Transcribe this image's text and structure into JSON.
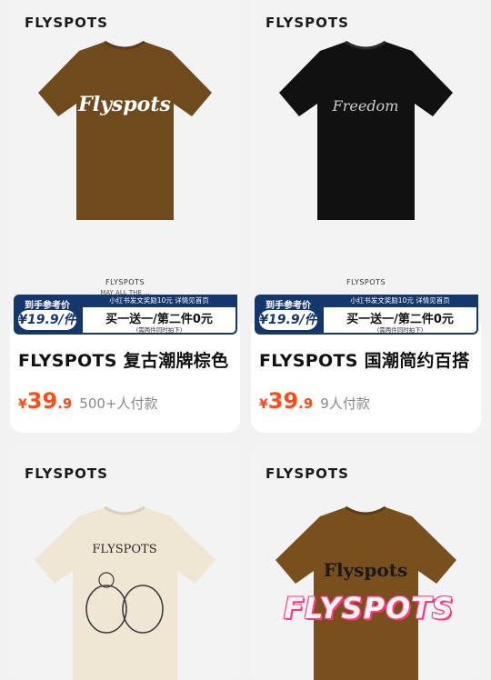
{
  "products": [
    {
      "logo": "FLYSPOTS",
      "shirt_print": "Flyspots",
      "brand_small": "FLYSPOTS",
      "tagline": "MAY ALL THE ...",
      "promo_label": "到手参考价",
      "promo_price": "¥19.9/件",
      "promo_top": "小红书发文奖励10元 详情见首页",
      "promo_deal": "买一送一/第二件0元",
      "promo_note": "(需两件同时拍下)",
      "title": "FLYSPOTS 复古潮牌棕色",
      "currency": "¥",
      "price_int": "39",
      "price_dec": ".9",
      "paid": "500+人付款",
      "shirt_color": "#6f4a1d",
      "print_color": "#ffffff"
    },
    {
      "logo": "FLYSPOTS",
      "shirt_print": "Freedom",
      "brand_small": "FLYSPOTS",
      "tagline": "",
      "promo_label": "到手参考价",
      "promo_price": "¥19.9/件",
      "promo_top": "小红书发文奖励10元 详情见首页",
      "promo_deal": "买一送一/第二件0元",
      "promo_note": "(需两件同时拍下)",
      "title": "FLYSPOTS 国潮简约百搭",
      "currency": "¥",
      "price_int": "39",
      "price_dec": ".9",
      "paid": "9人付款",
      "shirt_color": "#111111",
      "print_color": "#cccccc"
    },
    {
      "logo": "FLYSPOTS",
      "shirt_print": "FLYSPOTS",
      "shirt_color": "#efe6d4",
      "print_color": "#2b2b2b"
    },
    {
      "logo": "FLYSPOTS",
      "shirt_print": "Flyspots",
      "overlay": "FLYSPOTS",
      "shirt_color": "#7a4f1e",
      "print_color": "#1a1a1a"
    }
  ]
}
